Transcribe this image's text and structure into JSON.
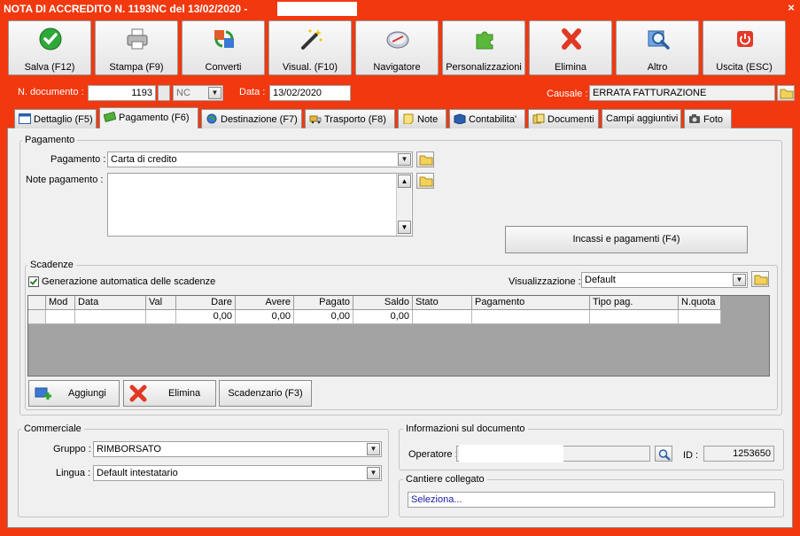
{
  "window": {
    "title": "NOTA DI ACCREDITO N. 1193NC del 13/02/2020 -",
    "close": "×"
  },
  "toolbar": {
    "salva": "Salva (F12)",
    "stampa": "Stampa (F9)",
    "converti": "Converti",
    "visual": "Visual. (F10)",
    "navigatore": "Navigatore",
    "personalizzazioni": "Personalizzazioni",
    "elimina": "Elimina",
    "altro": "Altro",
    "uscita": "Uscita (ESC)"
  },
  "header": {
    "ndoc_label": "N. documento :",
    "ndoc_value": "1193",
    "suffix_value": "NC",
    "data_label": "Data :",
    "data_value": "13/02/2020",
    "causale_label": "Causale :",
    "causale_value": "ERRATA FATTURAZIONE"
  },
  "tabs": {
    "dettaglio": "Dettaglio (F5)",
    "pagamento": "Pagamento (F6)",
    "destinazione": "Destinazione (F7)",
    "trasporto": "Trasporto (F8)",
    "note": "Note",
    "contabilita": "Contabilita'",
    "documenti": "Documenti",
    "campi": "Campi aggiuntivi",
    "foto": "Foto"
  },
  "pagamento": {
    "group": "Pagamento",
    "pag_label": "Pagamento :",
    "pag_value": "Carta di credito",
    "note_label": "Note pagamento :",
    "note_value": "",
    "incassi_button": "Incassi e pagamenti (F4)"
  },
  "scadenze": {
    "group": "Scadenze",
    "auto_label": "Generazione automatica delle scadenze",
    "auto_checked": true,
    "vis_label": "Visualizzazione :",
    "vis_value": "Default",
    "columns": [
      "Mod",
      "Data",
      "Val",
      "Dare",
      "Avere",
      "Pagato",
      "Saldo",
      "Stato",
      "Pagamento",
      "Tipo pag.",
      "N.quota"
    ],
    "row": [
      "",
      "",
      "",
      "0,00",
      "0,00",
      "0,00",
      "0,00",
      "",
      "",
      "",
      ""
    ],
    "aggiungi": "Aggiungi",
    "elimina": "Elimina",
    "scadenzario": "Scadenzario (F3)"
  },
  "commerciale": {
    "group": "Commerciale",
    "gruppo_label": "Gruppo :",
    "gruppo_value": "RIMBORSATO",
    "lingua_label": "Lingua :",
    "lingua_value": "Default intestatario"
  },
  "info": {
    "group": "Informazioni sul documento",
    "operatore_label": "Operatore :",
    "operatore_value": "",
    "id_label": "ID :",
    "id_value": "1253650"
  },
  "cantiere": {
    "group": "Cantiere collegato",
    "value": "Seleziona..."
  },
  "colors": {
    "frame": "#f2380e",
    "link": "#1a1aa6"
  }
}
